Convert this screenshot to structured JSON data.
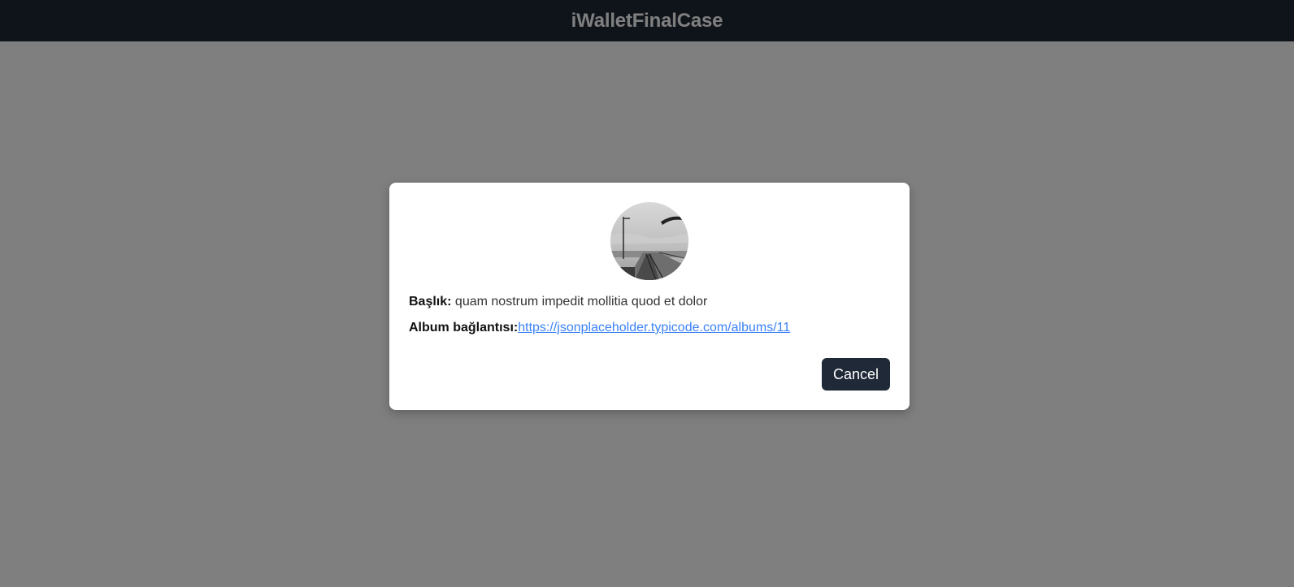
{
  "navbar": {
    "title": "iWalletFinalCase"
  },
  "modal": {
    "photo_icon": "pier-photo-thumbnail",
    "title_label": "Başlık:",
    "title_value": "quam nostrum impedit mollitia quod et dolor",
    "album_label": "Album bağlantısı:",
    "album_link": "https://jsonplaceholder.typicode.com/albums/11",
    "cancel_label": "Cancel"
  },
  "colors": {
    "navbar_bg": "#1f2937",
    "overlay": "rgba(0,0,0,0.5)",
    "link": "#3b82f6",
    "button_bg": "#1f2937"
  }
}
